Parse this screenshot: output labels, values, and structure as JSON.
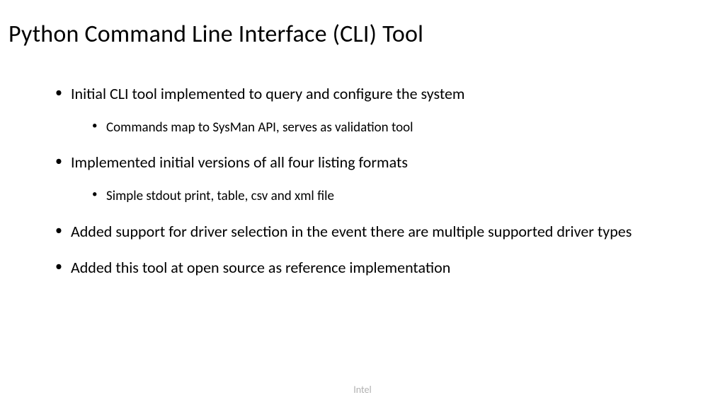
{
  "title": "Python Command Line Interface (CLI) Tool",
  "bullets": [
    {
      "text": "Initial CLI tool implemented to query and configure the system",
      "sub": [
        "Commands map to SysMan API, serves as validation tool"
      ]
    },
    {
      "text": "Implemented initial versions of all four listing formats",
      "sub": [
        "Simple stdout print, table, csv and xml file"
      ]
    },
    {
      "text": "Added support for driver selection in the event there are multiple supported driver types",
      "sub": []
    },
    {
      "text": "Added this tool at open source as reference implementation",
      "sub": []
    }
  ],
  "footer": "Intel"
}
